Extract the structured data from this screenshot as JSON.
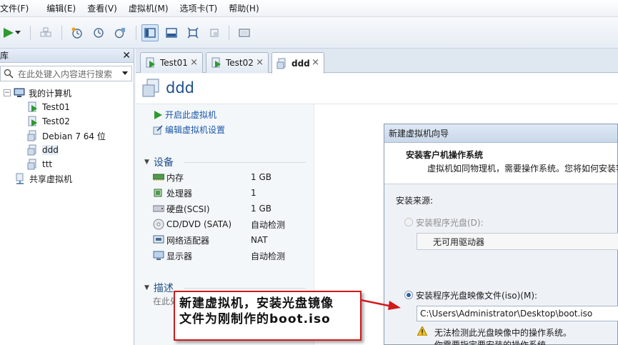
{
  "menubar": {
    "items": [
      {
        "label": "文件(F)"
      },
      {
        "label": "编辑(E)"
      },
      {
        "label": "查看(V)"
      },
      {
        "label": "虚拟机(M)"
      },
      {
        "label": "选项卡(T)"
      },
      {
        "label": "帮助(H)"
      }
    ]
  },
  "toolbar": {
    "icons": [
      "play-icon",
      "dropdown-arrow-icon",
      "send-ctrl-alt-del-icon",
      "snapshot-take-icon",
      "snapshot-revert-icon",
      "snapshot-manager-icon",
      "view-library-icon",
      "view-thumbnail-icon",
      "fullscreen-icon",
      "unity-icon",
      "console-view-icon"
    ],
    "accent": "#2e9a2e"
  },
  "library": {
    "title": "库",
    "search_placeholder": "在此处键入内容进行搜索",
    "tree": {
      "root_label": "我的计算机",
      "items": [
        {
          "label": "Test01",
          "state": "running"
        },
        {
          "label": "Test02",
          "state": "running"
        },
        {
          "label": "Debian 7 64 位",
          "state": "stopped"
        },
        {
          "label": "ddd",
          "state": "stopped"
        },
        {
          "label": "ttt",
          "state": "stopped"
        }
      ],
      "shared_label": "共享虚拟机"
    }
  },
  "tabs": [
    {
      "label": "Test01",
      "close": "×"
    },
    {
      "label": "Test02",
      "close": "×"
    },
    {
      "label": "ddd",
      "close": "×"
    }
  ],
  "vm": {
    "name": "ddd",
    "actions": {
      "power_on": "开启此虚拟机",
      "edit_settings": "编辑虚拟机设置"
    },
    "devices_title": "设备",
    "devices": [
      {
        "name": "内存",
        "value": "1 GB",
        "icon": "memory-icon"
      },
      {
        "name": "处理器",
        "value": "1",
        "icon": "cpu-icon"
      },
      {
        "name": "硬盘(SCSI)",
        "value": "1 GB",
        "icon": "hard-disk-icon"
      },
      {
        "name": "CD/DVD (SATA)",
        "value": "自动检测",
        "icon": "cd-dvd-icon"
      },
      {
        "name": "网络适配器",
        "value": "NAT",
        "icon": "network-adapter-icon"
      },
      {
        "name": "显示器",
        "value": "自动检测",
        "icon": "display-icon"
      }
    ],
    "description_title": "描述",
    "description_placeholder": "在此处"
  },
  "wizard": {
    "title": "新建虚拟机向导",
    "heading": "安装客户机操作系统",
    "subheading": "虚拟机如同物理机，需要操作系统。您将如何安装客",
    "source_label": "安装来源:",
    "option_disc_label": "安装程序光盘(D):",
    "disc_combo_value": "无可用驱动器",
    "option_iso_label": "安装程序光盘映像文件(iso)(M):",
    "iso_path": "C:\\Users\\Administrator\\Desktop\\boot.iso",
    "warning_line1": "无法检测此光盘映像中的操作系统。",
    "warning_line2": "你需要指定要安装的操作系统。"
  },
  "annotation": {
    "line1": "新建虚拟机，安装光盘镜像",
    "line2": "文件为刚制作的boot.iso",
    "border_color": "#d11a1a"
  }
}
